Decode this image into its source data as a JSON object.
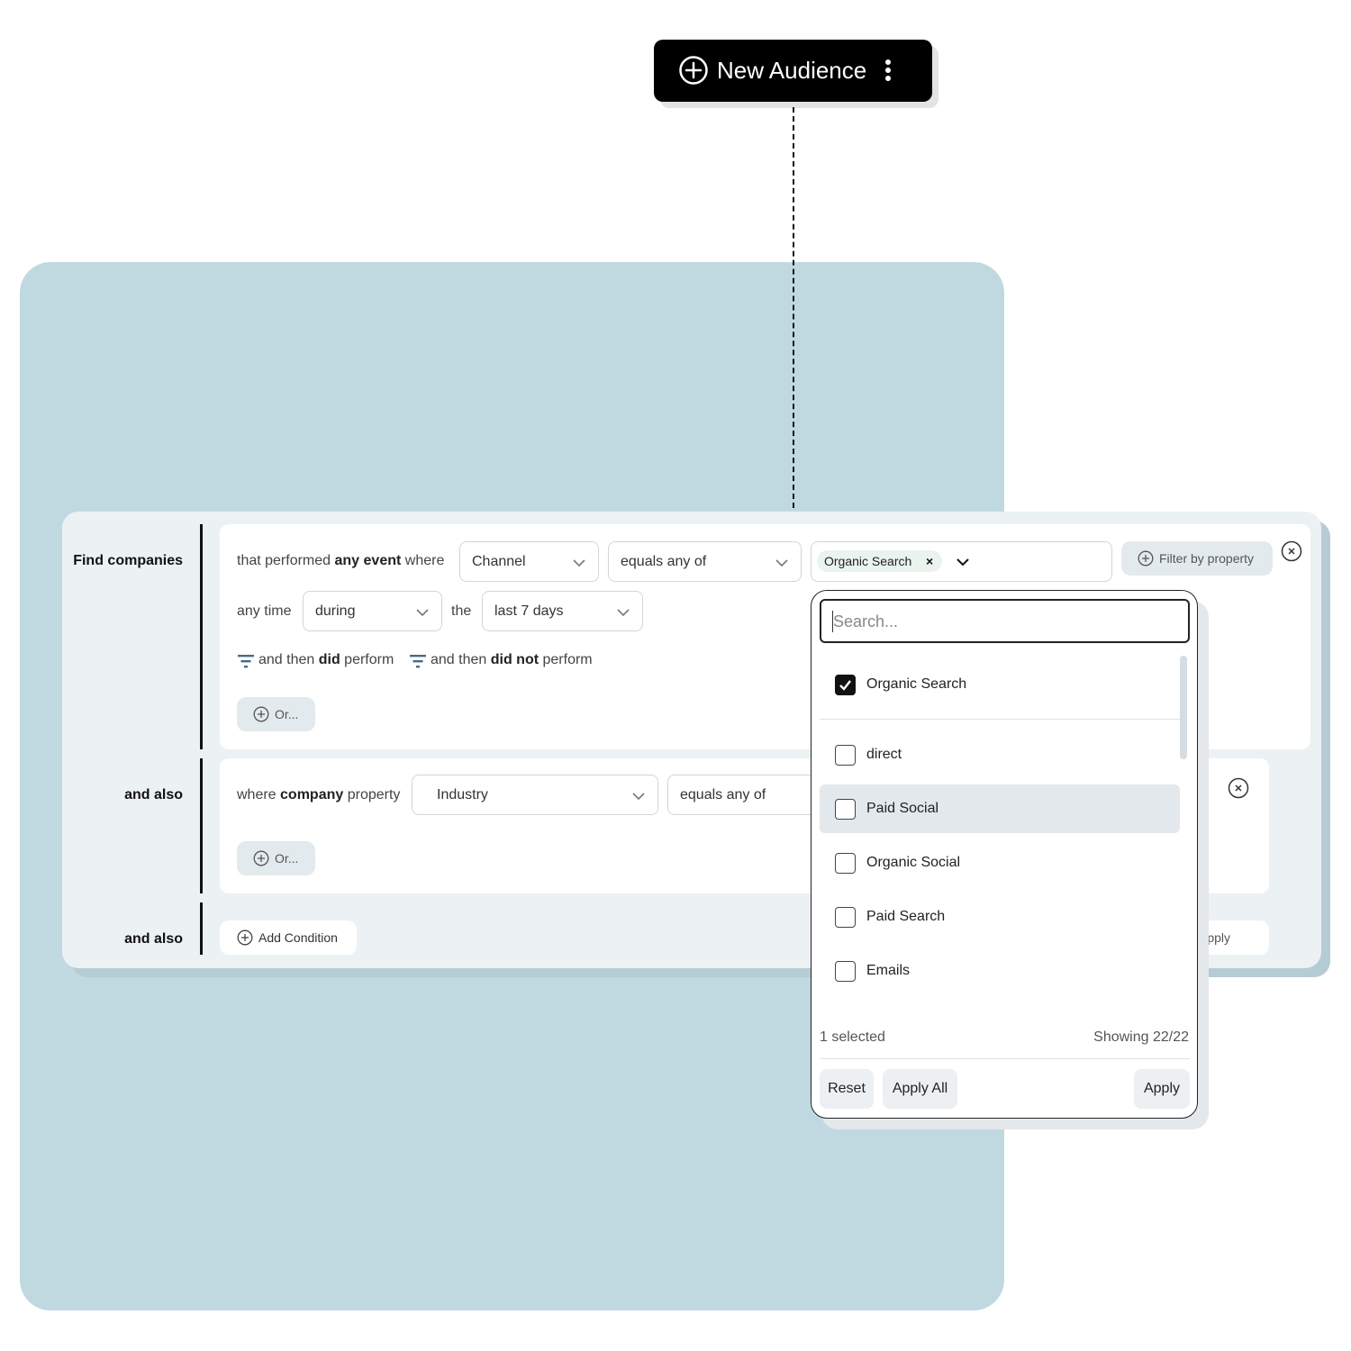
{
  "header": {
    "new_audience_label": "New Audience"
  },
  "builder": {
    "row1": {
      "label": "Find companies",
      "prefix": "that performed ",
      "prefix_bold": "any event",
      "prefix_suffix": " where",
      "property_select": "Channel",
      "operator_select": "equals any of",
      "chip_value": "Organic Search",
      "chip_remove": "×",
      "filter_by_property": "Filter by property",
      "time_prefix": "any time",
      "time_select": "during",
      "time_the": "the",
      "range_select": "last 7 days",
      "then_did_pre": "and then ",
      "then_did_bold": "did",
      "then_did_post": " perform",
      "then_not_pre": "and then ",
      "then_not_bold": "did not",
      "then_not_post": " perform",
      "or_button": "Or..."
    },
    "row2": {
      "label": "and also",
      "prefix": "where ",
      "prefix_bold": "company",
      "prefix_suffix": " property",
      "property_select": "Industry",
      "operator_select": "equals any of",
      "or_button": "Or..."
    },
    "row3": {
      "label": "and also",
      "add_condition": "Add Condition",
      "apply": "Apply"
    }
  },
  "dropdown": {
    "search_placeholder": "Search...",
    "options": [
      {
        "label": "Organic Search",
        "checked": true
      },
      {
        "label": "direct",
        "checked": false
      },
      {
        "label": "Paid Social",
        "checked": false
      },
      {
        "label": "Organic Social",
        "checked": false
      },
      {
        "label": "Paid Search",
        "checked": false
      },
      {
        "label": "Emails",
        "checked": false
      }
    ],
    "selected_count": "1 selected",
    "showing": "Showing 22/22",
    "reset": "Reset",
    "apply_all": "Apply All",
    "apply": "Apply"
  },
  "colors": {
    "background_panel": "#c0d9e1",
    "card": "#ecf1f4",
    "accent_dark": "#000000"
  }
}
